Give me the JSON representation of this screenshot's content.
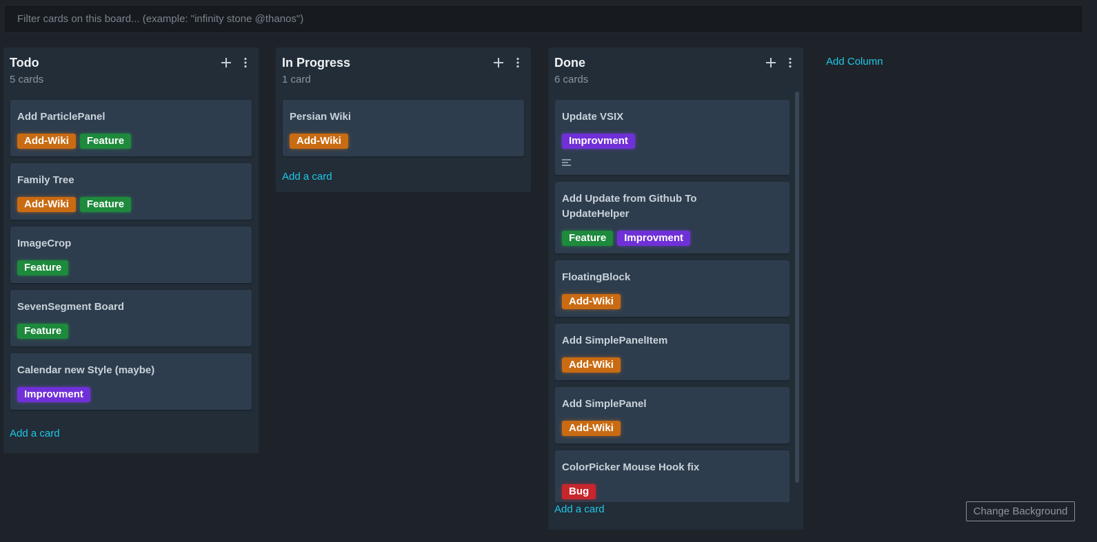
{
  "filter": {
    "placeholder": "Filter cards on this board... (example: \"infinity stone @thanos\")"
  },
  "columns": {
    "todo": {
      "title": "Todo",
      "count": "5 cards",
      "add_card": "Add a card",
      "cards": [
        {
          "title": "Add ParticlePanel",
          "labels": [
            "Add-Wiki",
            "Feature"
          ]
        },
        {
          "title": "Family Tree",
          "labels": [
            "Add-Wiki",
            "Feature"
          ]
        },
        {
          "title": "ImageCrop",
          "labels": [
            "Feature"
          ]
        },
        {
          "title": "SevenSegment Board",
          "labels": [
            "Feature"
          ]
        },
        {
          "title": "Calendar new Style (maybe)",
          "labels": [
            "Improvment"
          ]
        }
      ]
    },
    "progress": {
      "title": "In Progress",
      "count": "1 card",
      "add_card": "Add a card",
      "cards": [
        {
          "title": "Persian Wiki",
          "labels": [
            "Add-Wiki"
          ]
        }
      ]
    },
    "done": {
      "title": "Done",
      "count": "6 cards",
      "add_card": "Add a card",
      "cards": [
        {
          "title": "Update VSIX",
          "labels": [
            "Improvment"
          ],
          "has_description": true
        },
        {
          "title": "Add Update from Github To UpdateHelper",
          "labels": [
            "Feature",
            "Improvment"
          ]
        },
        {
          "title": "FloatingBlock",
          "labels": [
            "Add-Wiki"
          ]
        },
        {
          "title": "Add SimplePanelItem",
          "labels": [
            "Add-Wiki"
          ]
        },
        {
          "title": "Add SimplePanel",
          "labels": [
            "Add-Wiki"
          ]
        },
        {
          "title": "ColorPicker Mouse Hook fix",
          "labels": [
            "Bug"
          ]
        }
      ]
    }
  },
  "add_column": "Add Column",
  "change_background": "Change Background",
  "label_colors": {
    "Add-Wiki": "#c96b12",
    "Feature": "#1d8a3c",
    "Improvment": "#7030d8",
    "Bug": "#c8262d"
  },
  "icons": {
    "add": "plus-icon",
    "menu": "kebab-menu-icon",
    "description": "description-lines-icon"
  }
}
